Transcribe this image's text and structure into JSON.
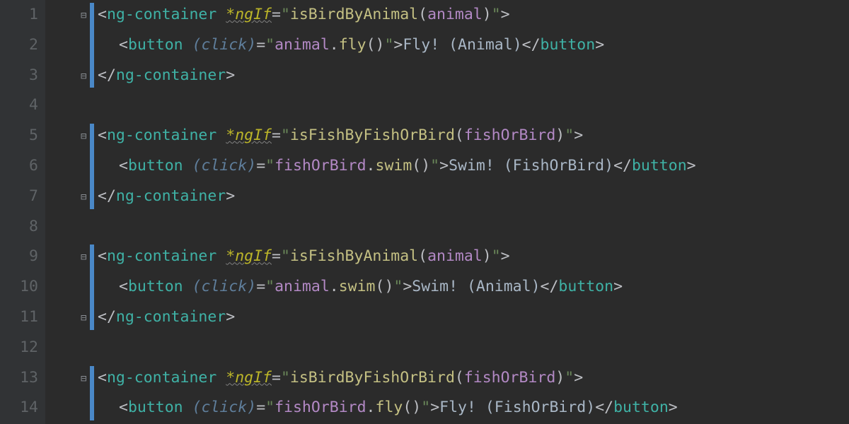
{
  "linecount": 14,
  "lines": {
    "l1": [
      [
        "<",
        "punc"
      ],
      [
        "ng-container",
        "tag"
      ],
      [
        " ",
        "text"
      ],
      [
        "*ngIf",
        "star",
        true
      ],
      [
        "=",
        "eq"
      ],
      [
        "\"",
        "q"
      ],
      [
        "isBirdByAnimal",
        "func"
      ],
      [
        "(",
        "punc"
      ],
      [
        "animal",
        "param"
      ],
      [
        ")",
        "punc"
      ],
      [
        "\"",
        "q"
      ],
      [
        ">",
        "punc"
      ]
    ],
    "l2": [
      [
        "<",
        "punc"
      ],
      [
        "button",
        "tag"
      ],
      [
        " ",
        "text"
      ],
      [
        "(click)",
        "attr"
      ],
      [
        "=",
        "eq"
      ],
      [
        "\"",
        "q"
      ],
      [
        "animal",
        "param"
      ],
      [
        ".",
        "dot"
      ],
      [
        "fly",
        "func"
      ],
      [
        "()",
        "punc"
      ],
      [
        "\"",
        "q"
      ],
      [
        ">",
        "punc"
      ],
      [
        "Fly! (Animal)",
        "text"
      ],
      [
        "</",
        "punc"
      ],
      [
        "button",
        "tag"
      ],
      [
        ">",
        "punc"
      ]
    ],
    "l3": [
      [
        "</",
        "punc"
      ],
      [
        "ng-container",
        "tag"
      ],
      [
        ">",
        "punc"
      ]
    ],
    "l5": [
      [
        "<",
        "punc"
      ],
      [
        "ng-container",
        "tag"
      ],
      [
        " ",
        "text"
      ],
      [
        "*ngIf",
        "star",
        true
      ],
      [
        "=",
        "eq"
      ],
      [
        "\"",
        "q"
      ],
      [
        "isFishByFishOrBird",
        "func"
      ],
      [
        "(",
        "punc"
      ],
      [
        "fishOrBird",
        "param"
      ],
      [
        ")",
        "punc"
      ],
      [
        "\"",
        "q"
      ],
      [
        ">",
        "punc"
      ]
    ],
    "l6": [
      [
        "<",
        "punc"
      ],
      [
        "button",
        "tag"
      ],
      [
        " ",
        "text"
      ],
      [
        "(click)",
        "attr"
      ],
      [
        "=",
        "eq"
      ],
      [
        "\"",
        "q"
      ],
      [
        "fishOrBird",
        "param"
      ],
      [
        ".",
        "dot"
      ],
      [
        "swim",
        "func"
      ],
      [
        "()",
        "punc"
      ],
      [
        "\"",
        "q"
      ],
      [
        ">",
        "punc"
      ],
      [
        "Swim! (FishOrBird)",
        "text"
      ],
      [
        "</",
        "punc"
      ],
      [
        "button",
        "tag"
      ],
      [
        ">",
        "punc"
      ]
    ],
    "l7": [
      [
        "</",
        "punc"
      ],
      [
        "ng-container",
        "tag"
      ],
      [
        ">",
        "punc"
      ]
    ],
    "l9": [
      [
        "<",
        "punc"
      ],
      [
        "ng-container",
        "tag"
      ],
      [
        " ",
        "text"
      ],
      [
        "*ngIf",
        "star",
        true
      ],
      [
        "=",
        "eq"
      ],
      [
        "\"",
        "q"
      ],
      [
        "isFishByAnimal",
        "func"
      ],
      [
        "(",
        "punc"
      ],
      [
        "animal",
        "param"
      ],
      [
        ")",
        "punc"
      ],
      [
        "\"",
        "q"
      ],
      [
        ">",
        "punc"
      ]
    ],
    "l10": [
      [
        "<",
        "punc"
      ],
      [
        "button",
        "tag"
      ],
      [
        " ",
        "text"
      ],
      [
        "(click)",
        "attr"
      ],
      [
        "=",
        "eq"
      ],
      [
        "\"",
        "q"
      ],
      [
        "animal",
        "param"
      ],
      [
        ".",
        "dot"
      ],
      [
        "swim",
        "func"
      ],
      [
        "()",
        "punc"
      ],
      [
        "\"",
        "q"
      ],
      [
        ">",
        "punc"
      ],
      [
        "Swim! (Animal)",
        "text"
      ],
      [
        "</",
        "punc"
      ],
      [
        "button",
        "tag"
      ],
      [
        ">",
        "punc"
      ]
    ],
    "l11": [
      [
        "</",
        "punc"
      ],
      [
        "ng-container",
        "tag"
      ],
      [
        ">",
        "punc"
      ]
    ],
    "l13": [
      [
        "<",
        "punc"
      ],
      [
        "ng-container",
        "tag"
      ],
      [
        " ",
        "text"
      ],
      [
        "*ngIf",
        "star",
        true
      ],
      [
        "=",
        "eq"
      ],
      [
        "\"",
        "q"
      ],
      [
        "isBirdByFishOrBird",
        "func"
      ],
      [
        "(",
        "punc"
      ],
      [
        "fishOrBird",
        "param"
      ],
      [
        ")",
        "punc"
      ],
      [
        "\"",
        "q"
      ],
      [
        ">",
        "punc"
      ]
    ],
    "l14": [
      [
        "<",
        "punc"
      ],
      [
        "button",
        "tag"
      ],
      [
        " ",
        "text"
      ],
      [
        "(click)",
        "attr"
      ],
      [
        "=",
        "eq"
      ],
      [
        "\"",
        "q"
      ],
      [
        "fishOrBird",
        "param"
      ],
      [
        ".",
        "dot"
      ],
      [
        "fly",
        "func"
      ],
      [
        "()",
        "punc"
      ],
      [
        "\"",
        "q"
      ],
      [
        ">",
        "punc"
      ],
      [
        "Fly! (FishOrBird)",
        "text"
      ],
      [
        "</",
        "punc"
      ],
      [
        "button",
        "tag"
      ],
      [
        ">",
        "punc"
      ]
    ]
  },
  "indent": {
    "l2": 2,
    "l6": 2,
    "l10": 2,
    "l14": 2
  },
  "bluebars": [
    [
      1,
      3
    ],
    [
      5,
      7
    ],
    [
      9,
      11
    ],
    [
      13,
      14
    ]
  ],
  "folds": {
    "open": [
      1,
      5,
      9,
      13
    ],
    "close": [
      3,
      7,
      11
    ]
  }
}
